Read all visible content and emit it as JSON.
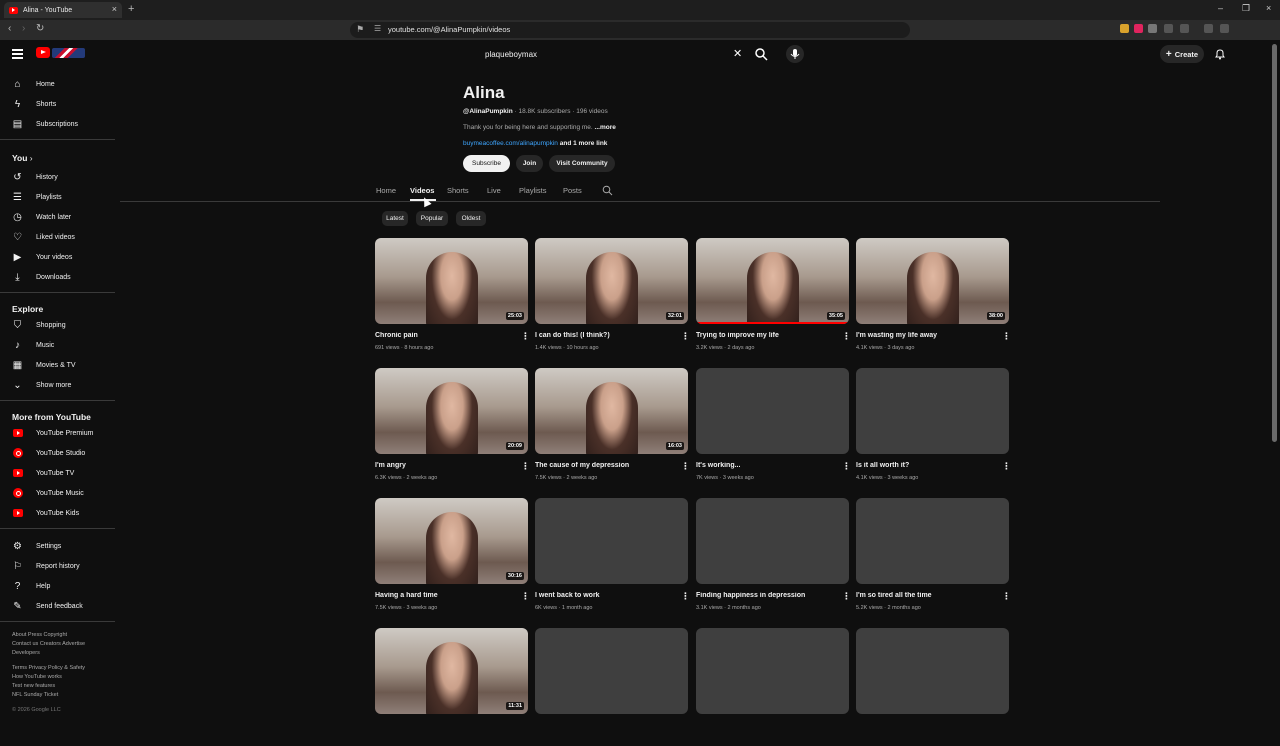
{
  "browser": {
    "tab_title": "Alina - YouTube",
    "url": "youtube.com/@AlinaPumpkin/videos"
  },
  "header": {
    "search_query": "plaqueboymax",
    "create_label": "Create"
  },
  "sidebar": {
    "main": [
      {
        "label": "Home",
        "icon": "home-icon"
      },
      {
        "label": "Shorts",
        "icon": "shorts-icon"
      },
      {
        "label": "Subscriptions",
        "icon": "subscriptions-icon"
      }
    ],
    "you_heading": "You",
    "you": [
      {
        "label": "History",
        "icon": "history-icon"
      },
      {
        "label": "Playlists",
        "icon": "playlists-icon"
      },
      {
        "label": "Watch later",
        "icon": "watch-later-icon"
      },
      {
        "label": "Liked videos",
        "icon": "like-icon"
      },
      {
        "label": "Your videos",
        "icon": "your-videos-icon"
      },
      {
        "label": "Downloads",
        "icon": "download-icon"
      }
    ],
    "explore_heading": "Explore",
    "explore": [
      {
        "label": "Shopping",
        "icon": "shopping-icon"
      },
      {
        "label": "Music",
        "icon": "music-icon"
      },
      {
        "label": "Movies & TV",
        "icon": "movies-icon"
      },
      {
        "label": "Show more",
        "icon": "chevron-down-icon"
      }
    ],
    "more_heading": "More from YouTube",
    "more": [
      {
        "label": "YouTube Premium"
      },
      {
        "label": "YouTube Studio"
      },
      {
        "label": "YouTube TV"
      },
      {
        "label": "YouTube Music"
      },
      {
        "label": "YouTube Kids"
      }
    ],
    "settings": [
      {
        "label": "Settings",
        "icon": "gear-icon"
      },
      {
        "label": "Report history",
        "icon": "flag-icon"
      },
      {
        "label": "Help",
        "icon": "help-icon"
      },
      {
        "label": "Send feedback",
        "icon": "feedback-icon"
      }
    ],
    "footer": {
      "line1": "About  Press  Copyright",
      "line2": "Contact us  Creators  Advertise",
      "line3": "Developers",
      "line4": "Terms  Privacy  Policy & Safety",
      "line5": "How YouTube works",
      "line6": "Test new features",
      "line7": "NFL Sunday Ticket",
      "copyright": "© 2026 Google LLC"
    }
  },
  "channel": {
    "name": "Alina",
    "handle": "@AlinaPumpkin",
    "stats": " · 18.8K subscribers · 196 videos",
    "description": "Thank you for being here and supporting me.",
    "more": " ...more",
    "link": "buymeacoffee.com/alinapumpkin",
    "more_links": " and 1 more link",
    "subscribe": "Subscribe",
    "join": "Join",
    "community": "Visit Community"
  },
  "tabs": [
    "Home",
    "Videos",
    "Shorts",
    "Live",
    "Playlists",
    "Posts"
  ],
  "active_tab": "Videos",
  "chips": [
    "Latest",
    "Popular",
    "Oldest"
  ],
  "videos": [
    {
      "title": "Chronic pain",
      "meta": "691 views · 8 hours ago",
      "duration": "25:03",
      "thumb": true
    },
    {
      "title": "I can do this! (I think?)",
      "meta": "1.4K views · 10 hours ago",
      "duration": "32:01",
      "thumb": true
    },
    {
      "title": "Trying to improve my life",
      "meta": "3.2K views · 2 days ago",
      "duration": "35:05",
      "thumb": true,
      "watched": true
    },
    {
      "title": "I'm wasting my life away",
      "meta": "4.1K views · 3 days ago",
      "duration": "38:00",
      "thumb": true
    },
    {
      "title": "I'm angry",
      "meta": "6.3K views · 2 weeks ago",
      "duration": "20:09",
      "thumb": true
    },
    {
      "title": "The cause of my depression",
      "meta": "7.5K views · 2 weeks ago",
      "duration": "16:03",
      "thumb": true
    },
    {
      "title": "It's working...",
      "meta": "7K views · 3 weeks ago",
      "duration": "",
      "thumb": false
    },
    {
      "title": "Is it all worth it?",
      "meta": "4.1K views · 3 weeks ago",
      "duration": "",
      "thumb": false
    },
    {
      "title": "Having a hard time",
      "meta": "7.5K views · 3 weeks ago",
      "duration": "30:16",
      "thumb": true
    },
    {
      "title": "I went back to work",
      "meta": "6K views · 1 month ago",
      "duration": "",
      "thumb": false
    },
    {
      "title": "Finding happiness in depression",
      "meta": "3.1K views · 2 months ago",
      "duration": "",
      "thumb": false
    },
    {
      "title": "I'm so tired all the time",
      "meta": "5.2K views · 2 months ago",
      "duration": "",
      "thumb": false
    },
    {
      "title": "",
      "meta": "",
      "duration": "11:31",
      "thumb": true
    },
    {
      "title": "",
      "meta": "",
      "duration": "",
      "thumb": false
    },
    {
      "title": "",
      "meta": "",
      "duration": "",
      "thumb": false
    },
    {
      "title": "",
      "meta": "",
      "duration": "",
      "thumb": false
    }
  ]
}
